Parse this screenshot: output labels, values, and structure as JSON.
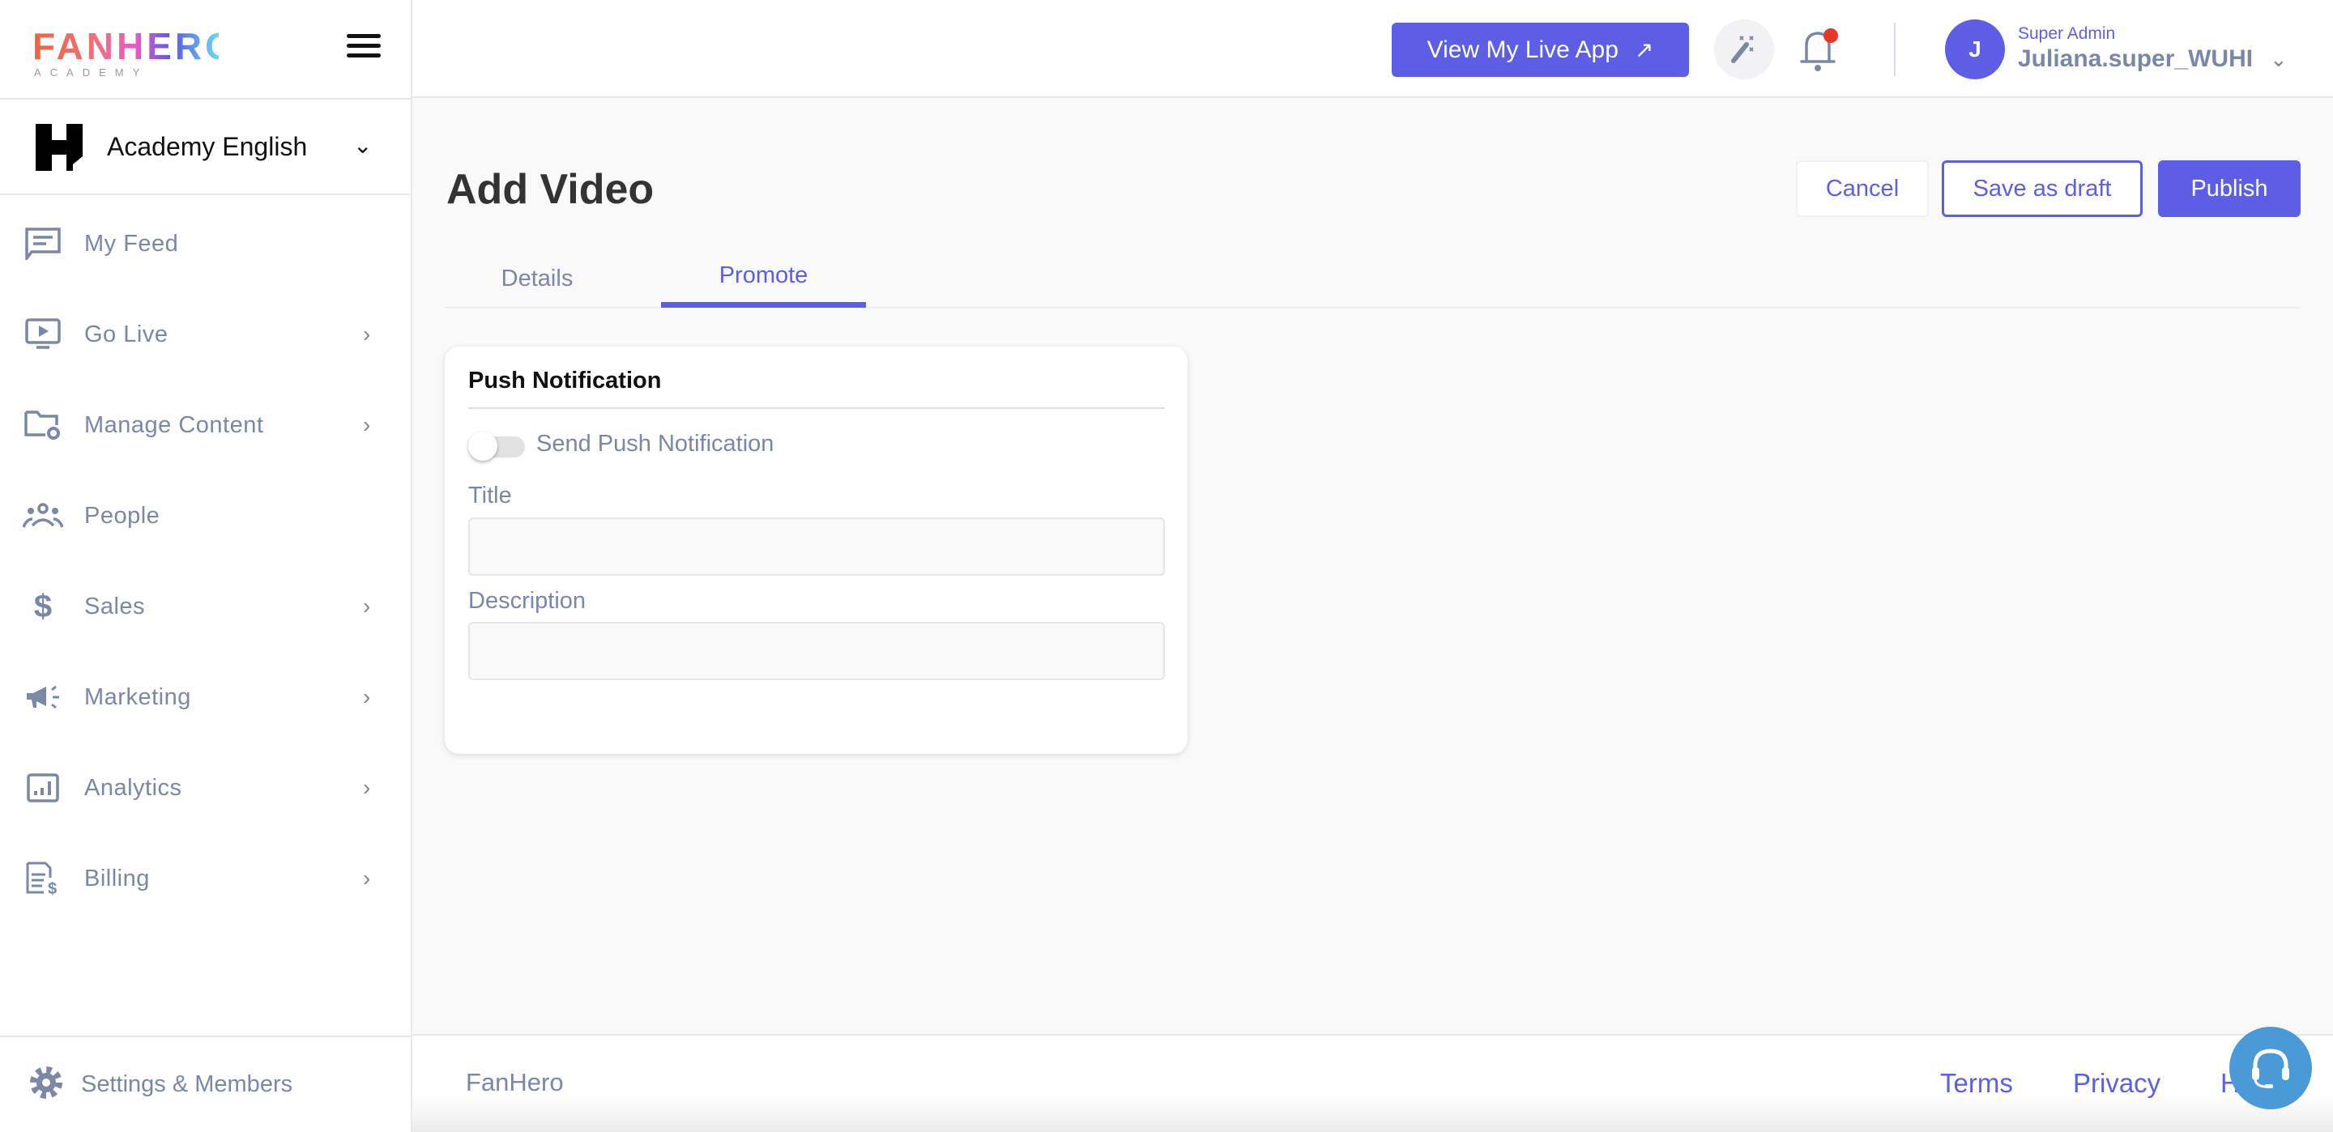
{
  "brand": {
    "logo_text": "FANHERO",
    "logo_sub": "ACADEMY"
  },
  "workspace": {
    "name": "Academy English"
  },
  "sidebar": {
    "items": [
      {
        "label": "My Feed",
        "icon": "feed-icon",
        "has_submenu": false
      },
      {
        "label": "Go Live",
        "icon": "play-screen-icon",
        "has_submenu": true
      },
      {
        "label": "Manage Content",
        "icon": "folder-gear-icon",
        "has_submenu": true
      },
      {
        "label": "People",
        "icon": "people-icon",
        "has_submenu": false
      },
      {
        "label": "Sales",
        "icon": "dollar-icon",
        "has_submenu": true
      },
      {
        "label": "Marketing",
        "icon": "megaphone-icon",
        "has_submenu": true
      },
      {
        "label": "Analytics",
        "icon": "chart-icon",
        "has_submenu": true
      },
      {
        "label": "Billing",
        "icon": "invoice-icon",
        "has_submenu": true
      }
    ],
    "settings_label": "Settings & Members"
  },
  "header": {
    "live_app_label": "View My Live App",
    "user_role": "Super Admin",
    "user_name": "Juliana.super_WUHI",
    "avatar_initial": "J",
    "notification_dot": true
  },
  "page": {
    "title": "Add Video",
    "cancel_label": "Cancel",
    "draft_label": "Save as draft",
    "publish_label": "Publish",
    "tabs": [
      {
        "label": "Details",
        "active": false
      },
      {
        "label": "Promote",
        "active": true
      }
    ]
  },
  "push": {
    "title": "Push Notification",
    "toggle_label": "Send Push Notification",
    "toggle_on": false,
    "title_label": "Title",
    "title_value": "",
    "description_label": "Description",
    "description_value": ""
  },
  "footer": {
    "brand": "FanHero",
    "links": [
      "Terms",
      "Privacy",
      "Help"
    ]
  },
  "colors": {
    "accent": "#5c5fe6",
    "muted": "#7a88a6",
    "notification": "#e8362a",
    "support": "#4a9ad8"
  }
}
